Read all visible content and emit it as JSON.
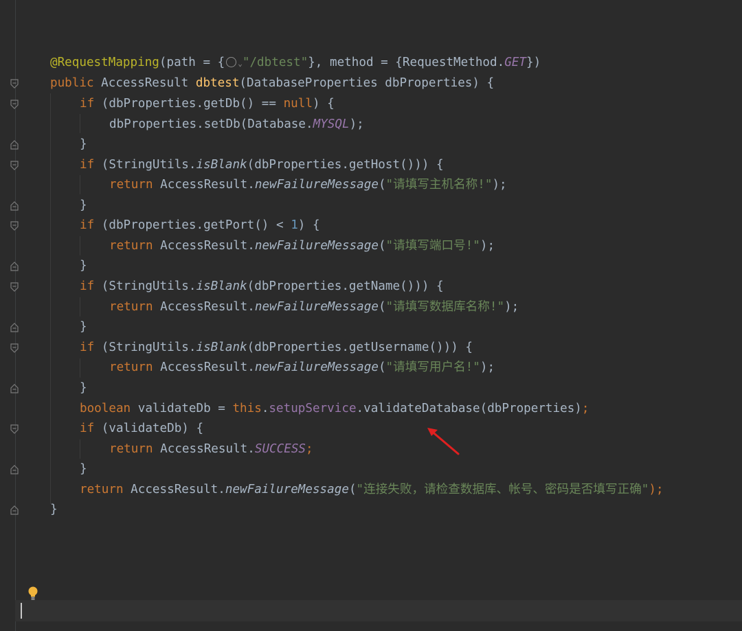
{
  "editor": {
    "lines": {
      "l1": {
        "annotation": "@RequestMapping",
        "p1": "(path = {",
        "p2": "\"/dbtest\"",
        "p3": "}, method = {RequestMethod.",
        "get": "GET",
        "p4": "})"
      },
      "l2": {
        "kw": "public",
        "p1": " AccessResult ",
        "fn": "dbtest",
        "p2": "(DatabaseProperties dbProperties) {"
      },
      "l3": {
        "kw": "if",
        "p1": " (dbProperties.getDb() == ",
        "null": "null",
        "p2": ") {"
      },
      "l4": {
        "p1": "dbProperties.setDb(Database.",
        "mysql": "MYSQL",
        "p2": ");"
      },
      "l5": {
        "p1": "}"
      },
      "l6": {
        "kw": "if",
        "p1": " (StringUtils.",
        "sm": "isBlank",
        "p2": "(dbProperties.getHost())) {"
      },
      "l7": {
        "kw": "return",
        "p1": " AccessResult.",
        "sm": "newFailureMessage",
        "p2": "(",
        "str": "\"请填写主机名称!\"",
        "p3": ");"
      },
      "l8": {
        "p1": "}"
      },
      "l9": {
        "kw": "if",
        "p1": " (dbProperties.getPort() < ",
        "num": "1",
        "p2": ") {"
      },
      "l10": {
        "kw": "return",
        "p1": " AccessResult.",
        "sm": "newFailureMessage",
        "p2": "(",
        "str": "\"请填写端口号!\"",
        "p3": ");"
      },
      "l11": {
        "p1": "}"
      },
      "l12": {
        "kw": "if",
        "p1": " (StringUtils.",
        "sm": "isBlank",
        "p2": "(dbProperties.getName())) {"
      },
      "l13": {
        "kw": "return",
        "p1": " AccessResult.",
        "sm": "newFailureMessage",
        "p2": "(",
        "str": "\"请填写数据库名称!\"",
        "p3": ");"
      },
      "l14": {
        "p1": "}"
      },
      "l15": {
        "kw": "if",
        "p1": " (StringUtils.",
        "sm": "isBlank",
        "p2": "(dbProperties.getUsername())) {"
      },
      "l16": {
        "kw": "return",
        "p1": " AccessResult.",
        "sm": "newFailureMessage",
        "p2": "(",
        "str": "\"请填写用户名!\"",
        "p3": ");"
      },
      "l17": {
        "p1": "}"
      },
      "l18": {
        "kw": "boolean",
        "p1": " validateDb = ",
        "kw2": "this",
        "p2": ".",
        "field": "setupService",
        "p3": ".validateDatabase(dbProperties)",
        "semi": ";"
      },
      "l19": {
        "kw": "if",
        "p1": " (validateDb) {"
      },
      "l20": {
        "kw": "return",
        "p1": " AccessResult.",
        "sf": "SUCCESS",
        "semi": ";"
      },
      "l21": {
        "p1": "}"
      },
      "l22": {
        "kw": "return",
        "p1": " AccessResult.",
        "sm": "newFailureMessage",
        "p2": "(",
        "str": "\"连接失败，请检查数据库、帐号、密码是否填写正确\"",
        "p3": ");"
      },
      "l23": {
        "p1": "}"
      }
    },
    "icons": {
      "fold": "fold-marker-icon",
      "globe": "globe-icon",
      "bulb": "lightbulb-icon",
      "arrow": "red-arrow-annotation"
    },
    "colors": {
      "background": "#2b2b2b",
      "keyword": "#cc7832",
      "annotation": "#bbb529",
      "string": "#6a8759",
      "field": "#9876aa",
      "arrow": "#e02020"
    }
  }
}
